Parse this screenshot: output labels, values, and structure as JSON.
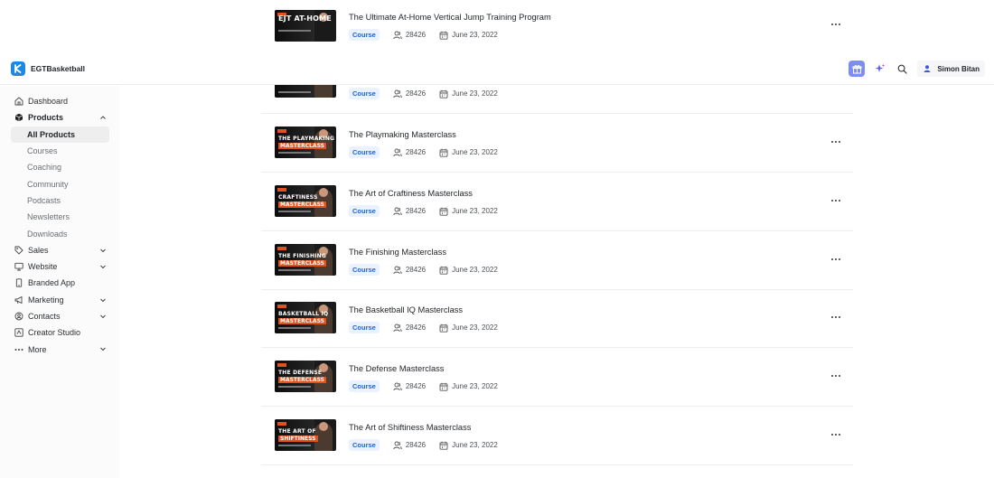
{
  "header": {
    "brand_name": "EGTBasketball",
    "user_name": "Simon Bitan",
    "icons": [
      "gift-icon",
      "sparkle-icon",
      "search-icon",
      "user-icon"
    ]
  },
  "sidebar": {
    "items": [
      {
        "label": "Dashboard",
        "icon": "home-icon"
      },
      {
        "label": "Products",
        "icon": "box-icon"
      },
      {
        "label": "All Products"
      },
      {
        "label": "Courses"
      },
      {
        "label": "Coaching"
      },
      {
        "label": "Community"
      },
      {
        "label": "Podcasts"
      },
      {
        "label": "Newsletters"
      },
      {
        "label": "Downloads"
      },
      {
        "label": "Sales",
        "icon": "tag-icon"
      },
      {
        "label": "Website",
        "icon": "monitor-icon"
      },
      {
        "label": "Branded App",
        "icon": "phone-icon"
      },
      {
        "label": "Marketing",
        "icon": "megaphone-icon"
      },
      {
        "label": "Contacts",
        "icon": "contacts-icon"
      },
      {
        "label": "Creator Studio",
        "icon": "studio-icon"
      },
      {
        "label": "More",
        "icon": "more-icon"
      }
    ]
  },
  "products": [
    {
      "title": "The Ultimate At-Home Vertical Jump Training Program",
      "type": "Course",
      "members": "28426",
      "date": "June 23, 2022",
      "thumb_line1": "EJT AT-HOME",
      "thumb_line2": ""
    },
    {
      "title": "",
      "type": "Course",
      "members": "28426",
      "date": "June 23, 2022",
      "thumb_line1": "",
      "thumb_line2": ""
    },
    {
      "title": "The Playmaking Masterclass",
      "type": "Course",
      "members": "28426",
      "date": "June 23, 2022",
      "thumb_line1": "THE PLAYMAKING",
      "thumb_line2": "MASTERCLASS"
    },
    {
      "title": "The Art of Craftiness Masterclass",
      "type": "Course",
      "members": "28426",
      "date": "June 23, 2022",
      "thumb_line1": "CRAFTINESS",
      "thumb_line2": "MASTERCLASS"
    },
    {
      "title": "The Finishing Masterclass",
      "type": "Course",
      "members": "28426",
      "date": "June 23, 2022",
      "thumb_line1": "THE FINISHING",
      "thumb_line2": "MASTERCLASS"
    },
    {
      "title": "The Basketball IQ Masterclass",
      "type": "Course",
      "members": "28426",
      "date": "June 23, 2022",
      "thumb_line1": "BASKETBALL IQ",
      "thumb_line2": "MASTERCLASS"
    },
    {
      "title": "The Defense Masterclass",
      "type": "Course",
      "members": "28426",
      "date": "June 23, 2022",
      "thumb_line1": "THE DEFENSE",
      "thumb_line2": "MASTERCLASS"
    },
    {
      "title": "The Art of Shiftiness Masterclass",
      "type": "Course",
      "members": "28426",
      "date": "June 23, 2022",
      "thumb_line1": "THE ART OF",
      "thumb_line2": "SHIFTINESS"
    }
  ],
  "colors": {
    "accent": "#1e88e5",
    "badge_bg": "#eaf2ff",
    "badge_text": "#1a64d6",
    "gift_bg": "#7c8cf8",
    "thumb_orange": "#e0531f"
  }
}
